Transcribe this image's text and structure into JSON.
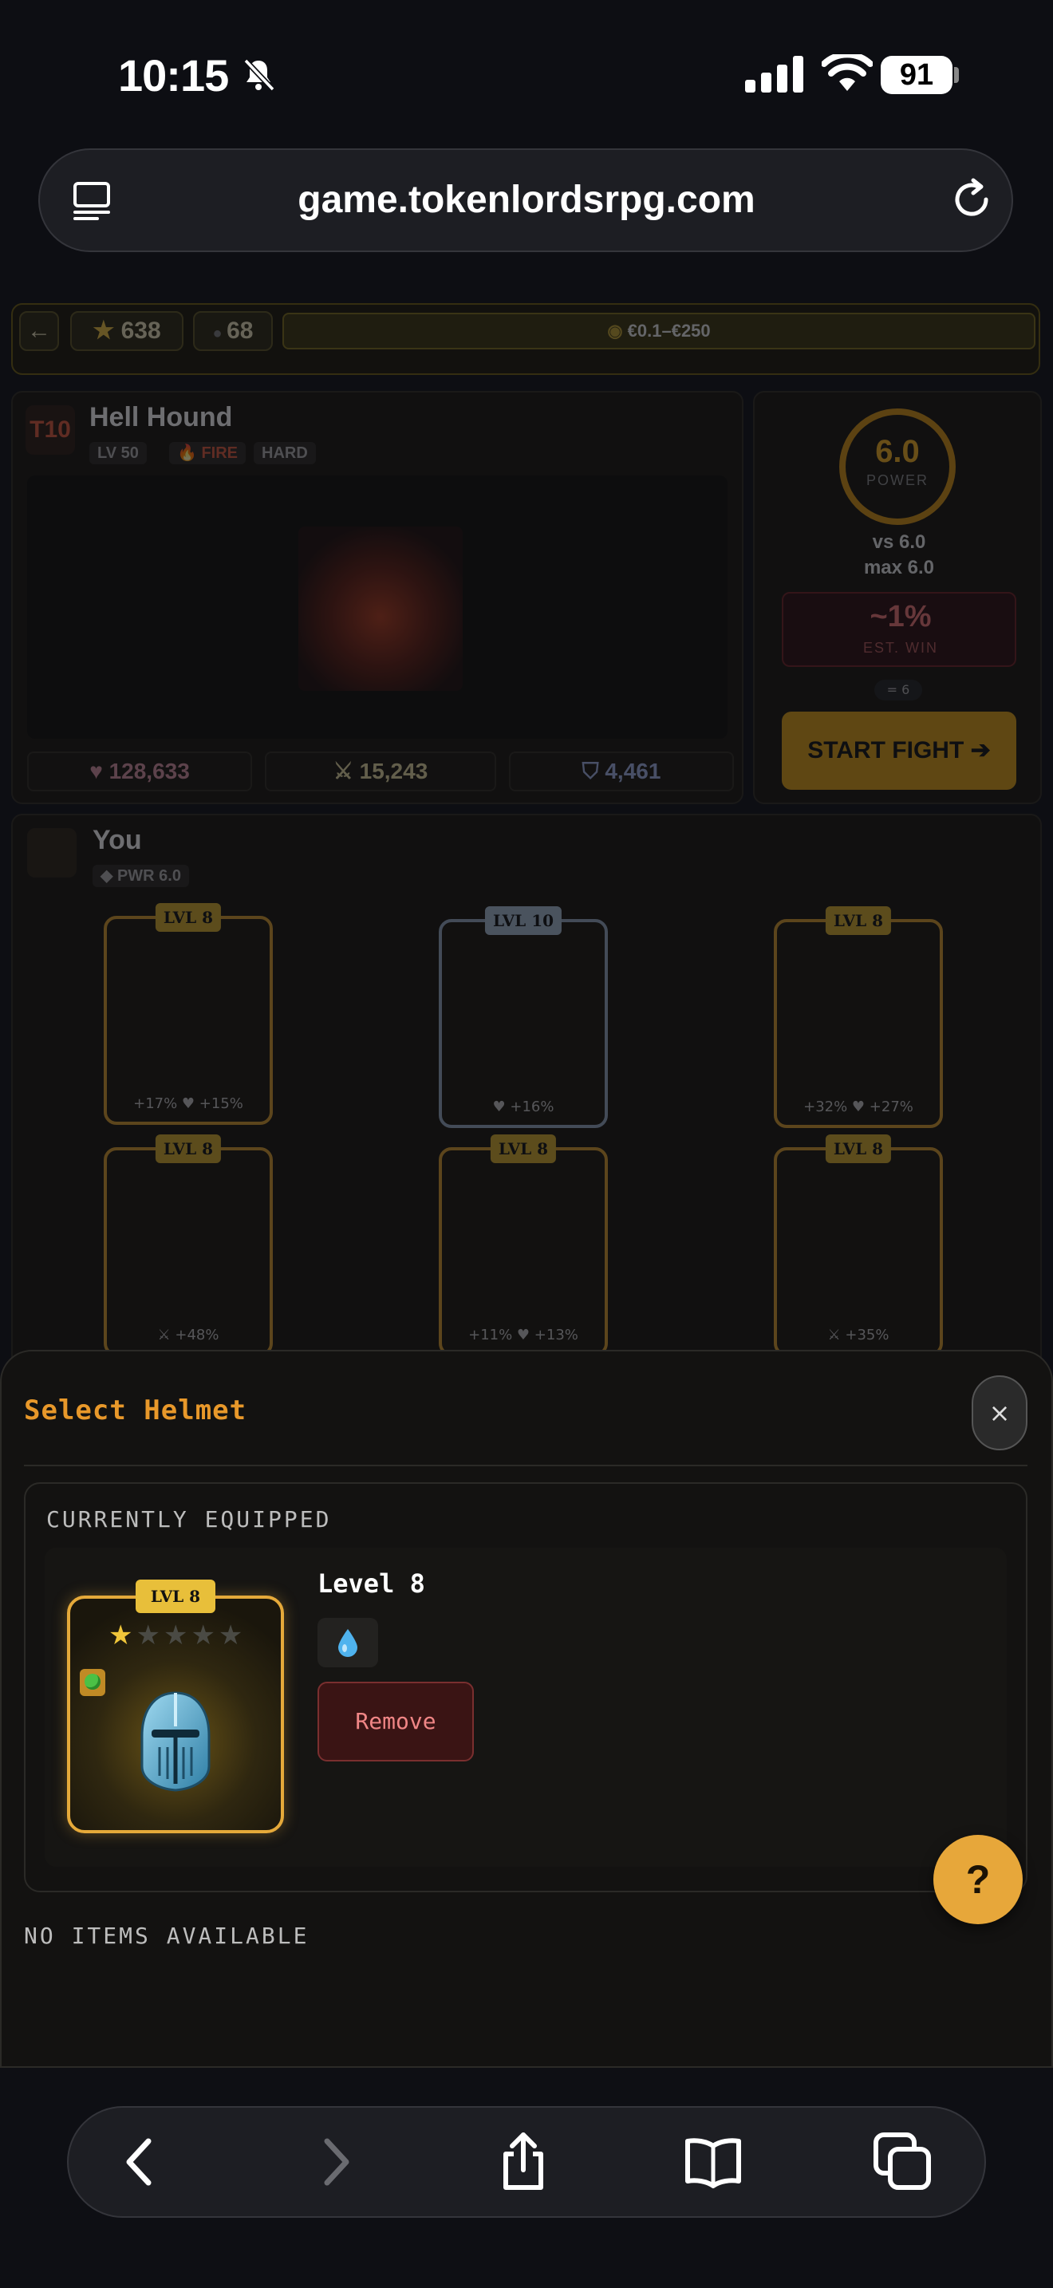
{
  "status": {
    "time": "10:15",
    "battery": "91"
  },
  "browser": {
    "url": "game.tokenlordsrpg.com"
  },
  "topbar": {
    "back": "←",
    "stars": "638",
    "gems": "68",
    "prize": "€0.1–€250"
  },
  "enemy": {
    "tier": "T10",
    "name": "Hell Hound",
    "level": "LV 50",
    "element": "FIRE",
    "difficulty": "HARD",
    "hp": "128,633",
    "attack": "15,243",
    "defense": "4,461"
  },
  "power": {
    "value": "6.0",
    "label": "POWER",
    "vs": "vs 6.0",
    "max": "max 6.0",
    "win_pct": "~1%",
    "win_label": "EST. WIN",
    "count": "6",
    "fight_label": "START FIGHT"
  },
  "player": {
    "name": "You",
    "power": "PWR 6.0"
  },
  "gear": [
    {
      "level": "LVL 8",
      "stats": "+17% ♥ +15%",
      "item": "helmet",
      "stars": 1,
      "rarity_color": "#c9922a"
    },
    {
      "level": "LVL 10",
      "stats": "♥ +16%",
      "item": "amulet",
      "stars": 1,
      "rarity_color": "#8da0b6"
    },
    {
      "level": "LVL 8",
      "stats": "+32% ♥ +27%",
      "item": "chest-armor",
      "stars": 1,
      "rarity_color": "#c9922a"
    },
    {
      "level": "LVL 8",
      "stats": "⚔ +48%",
      "item": "sword",
      "stars": 1,
      "rarity_color": "#c9922a"
    },
    {
      "level": "LVL 8",
      "stats": "+11% ♥ +13%",
      "item": "boots",
      "stars": 1,
      "rarity_color": "#c9922a"
    },
    {
      "level": "LVL 8",
      "stats": "⚔ +35%",
      "item": "ring",
      "stars": 1,
      "rarity_color": "#c9922a"
    }
  ],
  "sheet": {
    "title": "Select Helmet",
    "close": "×",
    "equipped_label": "CURRENTLY EQUIPPED",
    "equipped": {
      "level_badge": "LVL 8",
      "name": "Level 8",
      "stars": 1,
      "element_icon": "water-drop-icon"
    },
    "remove_label": "Remove",
    "empty_label": "NO ITEMS AVAILABLE",
    "help": "?"
  },
  "colors": {
    "accent": "#e8982a",
    "gold": "#e5a93a",
    "danger": "#f08686"
  }
}
